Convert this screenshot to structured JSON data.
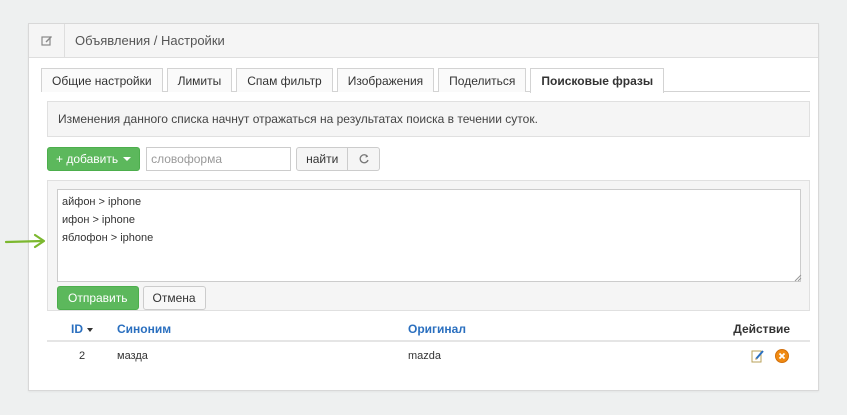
{
  "header": {
    "title": "Объявления / Настройки",
    "icon": "edit-icon"
  },
  "tabs": [
    {
      "label": "Общие настройки",
      "active": false
    },
    {
      "label": "Лимиты",
      "active": false
    },
    {
      "label": "Спам фильтр",
      "active": false
    },
    {
      "label": "Изображения",
      "active": false
    },
    {
      "label": "Поделиться",
      "active": false
    },
    {
      "label": "Поисковые фразы",
      "active": true
    }
  ],
  "notice": "Изменения данного списка начнут отражаться на результатах поиска в течении суток.",
  "toolbar": {
    "add_label": "+ добавить",
    "search_placeholder": "словоформа",
    "find_label": "найти"
  },
  "form": {
    "textarea_value": "айфон > iphone\nифон > iphone\nяблофон > iphone",
    "submit_label": "Отправить",
    "cancel_label": "Отмена"
  },
  "table": {
    "headers": {
      "id": "ID",
      "synonym": "Синоним",
      "original": "Оригинал",
      "action": "Действие"
    },
    "rows": [
      {
        "id": "2",
        "synonym": "мазда",
        "original": "mazda"
      }
    ]
  },
  "colors": {
    "accent_green": "#5cb85c",
    "link_blue": "#2a6fbf",
    "arrow_green": "#7cb82f"
  }
}
